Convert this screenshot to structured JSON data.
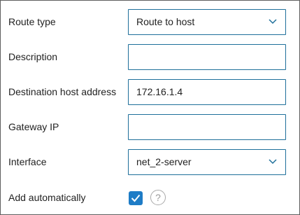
{
  "form": {
    "route_type": {
      "label": "Route type",
      "value": "Route to host",
      "control": "dropdown"
    },
    "description": {
      "label": "Description",
      "value": ""
    },
    "destination": {
      "label": "Destination host address",
      "value": "172.16.1.4"
    },
    "gateway": {
      "label": "Gateway IP",
      "value": ""
    },
    "interface": {
      "label": "Interface",
      "value": "net_2-server",
      "control": "dropdown"
    },
    "add_automatically": {
      "label": "Add automatically",
      "checked": true,
      "help_icon": "?"
    }
  },
  "colors": {
    "field_border": "#1e6f9a",
    "checkbox_fill": "#1e7cc6",
    "frame_border": "#5f5f5f"
  },
  "icons": {
    "dropdown": "chevron-down-icon",
    "checkbox": "checkmark-icon",
    "help": "help-circle-icon"
  }
}
